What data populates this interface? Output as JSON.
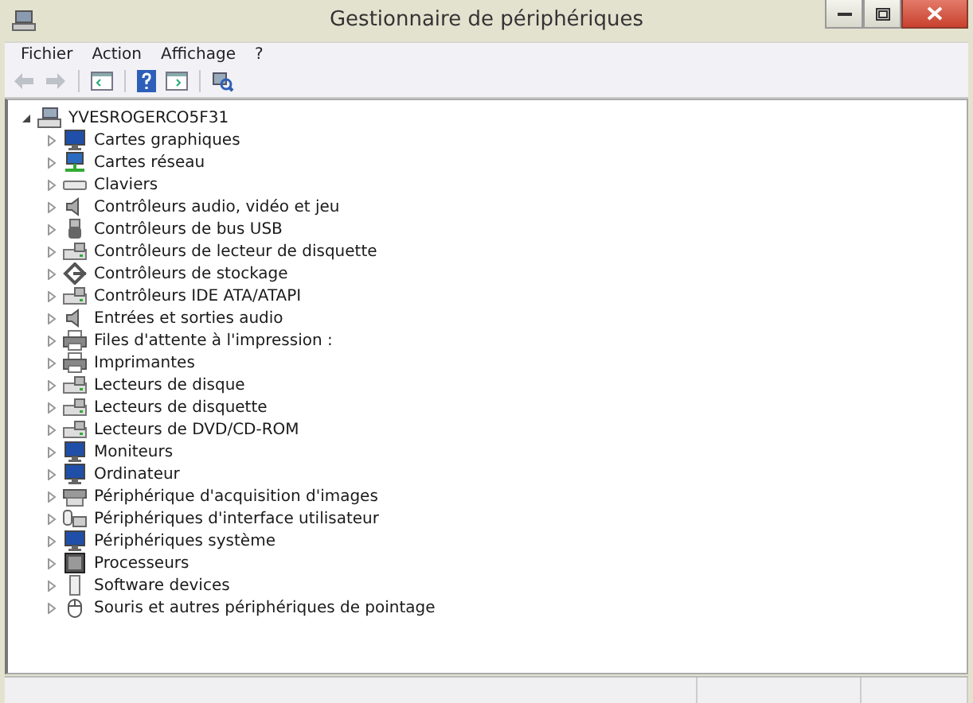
{
  "window": {
    "title": "Gestionnaire de périphériques"
  },
  "menu": [
    "Fichier",
    "Action",
    "Affichage",
    "?"
  ],
  "toolbar": [
    {
      "kind": "back",
      "disabled": true
    },
    {
      "kind": "forward",
      "disabled": true
    },
    {
      "kind": "sep"
    },
    {
      "kind": "tree-pane",
      "disabled": false
    },
    {
      "kind": "sep"
    },
    {
      "kind": "help",
      "disabled": false
    },
    {
      "kind": "action-pane",
      "disabled": false
    },
    {
      "kind": "sep"
    },
    {
      "kind": "scan",
      "disabled": false
    }
  ],
  "tree": {
    "label": "YVESROGERCO5F31",
    "expanded": true,
    "children": [
      {
        "label": "Cartes graphiques",
        "kind": "monitor",
        "expanded": false
      },
      {
        "label": "Cartes réseau",
        "kind": "network",
        "expanded": false
      },
      {
        "label": "Claviers",
        "kind": "keyboard",
        "expanded": false
      },
      {
        "label": "Contrôleurs audio, vidéo et jeu",
        "kind": "speaker",
        "expanded": false
      },
      {
        "label": "Contrôleurs de bus USB",
        "kind": "usb",
        "expanded": false
      },
      {
        "label": "Contrôleurs de lecteur de disquette",
        "kind": "drive",
        "expanded": false
      },
      {
        "label": "Contrôleurs de stockage",
        "kind": "storage",
        "expanded": false
      },
      {
        "label": "Contrôleurs IDE ATA/ATAPI",
        "kind": "drive",
        "expanded": false
      },
      {
        "label": "Entrées et sorties audio",
        "kind": "speaker",
        "expanded": false
      },
      {
        "label": "Files d'attente à l'impression :",
        "kind": "printer",
        "expanded": false
      },
      {
        "label": "Imprimantes",
        "kind": "printer",
        "expanded": false
      },
      {
        "label": "Lecteurs de disque",
        "kind": "drive",
        "expanded": false
      },
      {
        "label": "Lecteurs de disquette",
        "kind": "drive",
        "expanded": false
      },
      {
        "label": "Lecteurs de DVD/CD-ROM",
        "kind": "drive",
        "expanded": false
      },
      {
        "label": "Moniteurs",
        "kind": "monitor",
        "expanded": false
      },
      {
        "label": "Ordinateur",
        "kind": "monitor",
        "expanded": false
      },
      {
        "label": "Périphérique d'acquisition d'images",
        "kind": "scanner",
        "expanded": false
      },
      {
        "label": "Périphériques d'interface utilisateur",
        "kind": "hid",
        "expanded": false
      },
      {
        "label": "Périphériques système",
        "kind": "monitor",
        "expanded": false
      },
      {
        "label": "Processeurs",
        "kind": "chip",
        "expanded": false
      },
      {
        "label": "Software devices",
        "kind": "device",
        "expanded": false
      },
      {
        "label": "Souris et autres périphériques de pointage",
        "kind": "mouse",
        "expanded": false
      }
    ]
  }
}
